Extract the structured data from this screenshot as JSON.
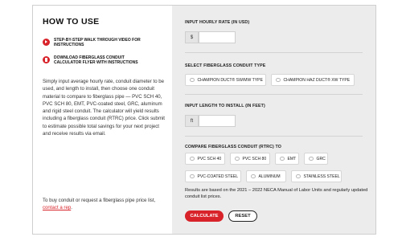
{
  "how_to_use": {
    "title": "HOW TO USE",
    "links": [
      {
        "label": "STEP-BY-STEP WALK THROUGH VIDEO FOR INSTRUCTIONS",
        "icon": "play-icon"
      },
      {
        "label": "DOWNLOAD FIBERGLASS CONDUIT CALCULATOR FLYER WITH INSTRUCTIONS",
        "icon": "document-icon"
      }
    ],
    "description": "Simply input average hourly rate, conduit diameter to be used, and length to install, then choose one conduit material to compare to fiberglass pipe — PVC SCH 40, PVC SCH 80, EMT, PVC-coated steel, GRC, aluminum and rigid steel conduit. The calculator will yield results including a fiberglass conduit (RTRC) price. Click submit to estimate possible total savings for your next project and receive results via email.",
    "buy_prefix": "To buy conduit or request a fiberglass pipe price list, ",
    "buy_link": "contact a rep",
    "buy_suffix": "."
  },
  "form": {
    "hourly_rate": {
      "label": "INPUT HOURLY RATE (IN USD)",
      "prefix": "$",
      "value": ""
    },
    "conduit_type": {
      "label": "SELECT FIBERGLASS CONDUIT TYPE",
      "options": [
        "CHAMPION DUCT® SW/MW TYPE",
        "CHAMPION HAZ DUCT® XW TYPE"
      ]
    },
    "length": {
      "label": "INPUT LENGTH TO INSTALL (IN FEET)",
      "suffix": "ft",
      "value": ""
    },
    "compare": {
      "label": "COMPARE FIBERGLASS CONDUIT (RTRC) TO",
      "row1": [
        "PVC SCH 40",
        "PVC SCH 80",
        "EMT",
        "GRC"
      ],
      "row2": [
        "PVC-COATED STEEL",
        "ALUMINUM",
        "STAINLESS STEEL"
      ]
    },
    "note": "Results are based on the 2021 – 2022 NECA Manual of Labor Units and regularly updated conduit list prices.",
    "calculate_label": "CALCULATE",
    "reset_label": "RESET"
  },
  "colors": {
    "accent": "#d8232a",
    "panel": "#ececec"
  }
}
